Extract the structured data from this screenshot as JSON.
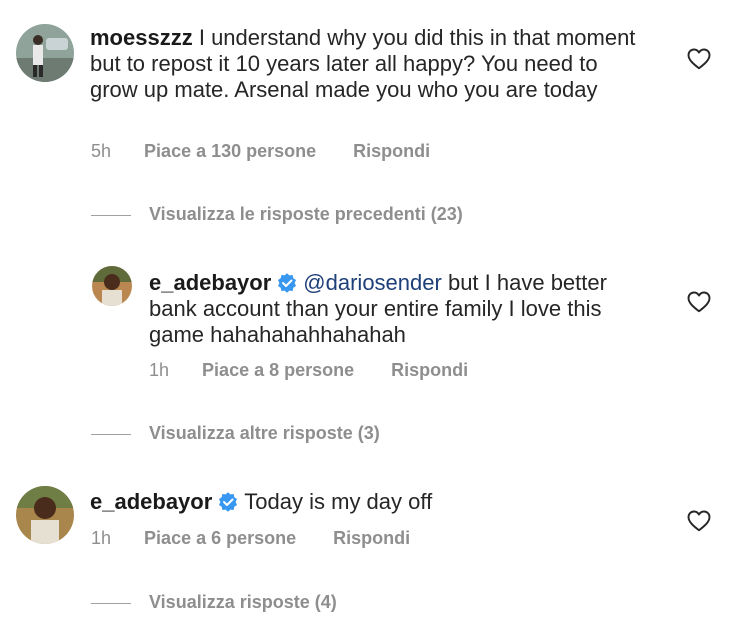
{
  "comments": [
    {
      "username": "moesszzz",
      "text": "I understand why you did this in that moment but to repost it 10 years later all happy? You need to grow up mate. Arsenal made you who you are today",
      "time": "5h",
      "likes": "Piace a 130 persone",
      "reply": "Rispondi"
    },
    {
      "username": "e_adebayor",
      "verified": true,
      "mention": "@dariosender",
      "text": "but I have better bank account than your entire family I love this game hahahahahhahahah",
      "time": "1h",
      "likes": "Piace a 8 persone",
      "reply": "Rispondi"
    },
    {
      "username": "e_adebayor",
      "verified": true,
      "text": "Today is my day off",
      "time": "1h",
      "likes": "Piace a 6 persone",
      "reply": "Rispondi"
    }
  ],
  "thread_toggles": {
    "previous_replies": "Visualizza le risposte precedenti (23)",
    "more_replies": "Visualizza altre risposte (3)",
    "view_replies": "Visualizza risposte (4)"
  },
  "icons": {
    "like": "heart-icon",
    "verified": "verified-badge-icon"
  },
  "colors": {
    "verified_badge": "#3897f0",
    "mention": "#1f3f79",
    "secondary_text": "#8e8e8e"
  }
}
